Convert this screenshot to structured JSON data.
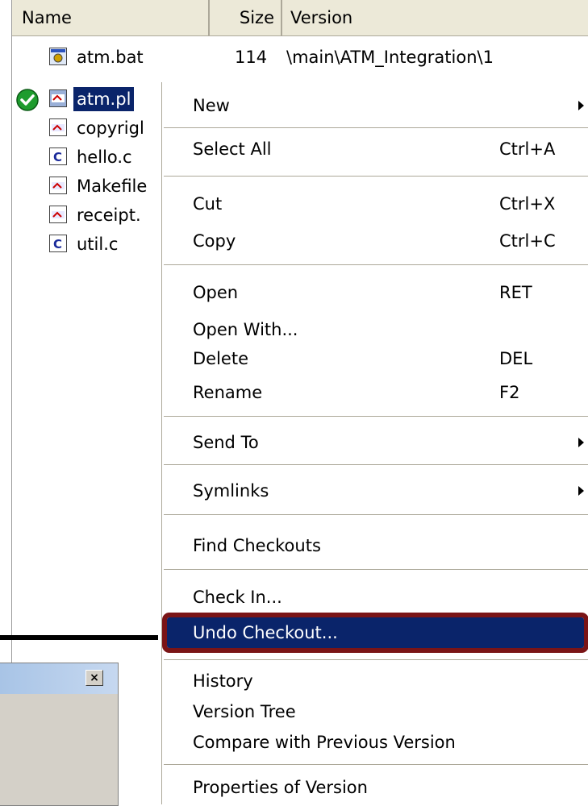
{
  "columns": {
    "name": "Name",
    "size": "Size",
    "version": "Version"
  },
  "files": [
    {
      "name": "atm.bat",
      "size": "114",
      "version": "\\main\\ATM_Integration\\1",
      "icon": "batch-file-icon"
    },
    {
      "name": "atm.pl",
      "size": "",
      "version": "",
      "icon": "perl-file-icon",
      "selected": true,
      "checked_out": true
    },
    {
      "name": "copyrigl",
      "size": "",
      "version": "",
      "icon": "text-file-icon"
    },
    {
      "name": "hello.c",
      "size": "",
      "version": "",
      "icon": "c-file-icon"
    },
    {
      "name": "Makefile",
      "size": "",
      "version": "",
      "icon": "text-file-icon"
    },
    {
      "name": "receipt.",
      "size": "",
      "version": "",
      "icon": "text-file-icon"
    },
    {
      "name": "util.c",
      "size": "",
      "version": "",
      "icon": "c-file-icon"
    }
  ],
  "menu": {
    "new": "New",
    "select_all": "Select All",
    "select_all_sc": "Ctrl+A",
    "cut": "Cut",
    "cut_sc": "Ctrl+X",
    "copy": "Copy",
    "copy_sc": "Ctrl+C",
    "open": "Open",
    "open_sc": "RET",
    "open_with": "Open With...",
    "delete": "Delete",
    "delete_sc": "DEL",
    "rename": "Rename",
    "rename_sc": "F2",
    "send_to": "Send To",
    "symlinks": "Symlinks",
    "find_checkouts": "Find Checkouts",
    "check_in": "Check In...",
    "undo_checkout": "Undo Checkout...",
    "history": "History",
    "version_tree": "Version Tree",
    "compare": "Compare with Previous Version",
    "properties": "Properties of Version"
  },
  "dialog": {
    "close_glyph": "×"
  },
  "colors": {
    "selection": "#0a246a",
    "highlight_outline": "#7a1416",
    "check_green": "#1e9c2e"
  }
}
